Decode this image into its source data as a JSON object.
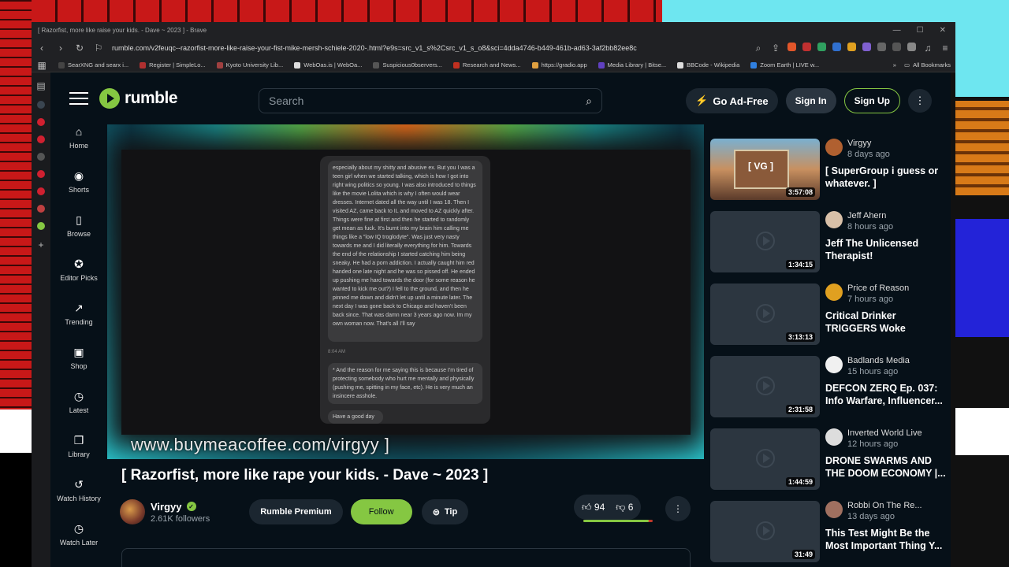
{
  "browser": {
    "title": "[ Razorfist, more like raise your kids. - Dave ~ 2023 ] - Brave",
    "url": "rumble.com/v2feuqc--razorfist-more-like-raise-your-fist-mike-mersh-schiele-2020-.html?e9s=src_v1_s%2Csrc_v1_s_o8&sci=4dda4746-b449-461b-ad63-3af2bb82ee8c",
    "window_controls": [
      "—",
      "☐",
      "✕"
    ],
    "bookmarks": [
      {
        "label": "SearXNG and searx i...",
        "color": "#444"
      },
      {
        "label": "Register | SimpleLo...",
        "color": "#b03030"
      },
      {
        "label": "Kyoto University Lib...",
        "color": "#a04040"
      },
      {
        "label": "WebOas.is | WebOa...",
        "color": "#ddd"
      },
      {
        "label": "Suspicious0bservers...",
        "color": "#555"
      },
      {
        "label": "Research and News...",
        "color": "#c03020"
      },
      {
        "label": "https://gradio.app",
        "color": "#e0a040"
      },
      {
        "label": "Media Library | Bitse...",
        "color": "#6040c0"
      },
      {
        "label": "BBCode - Wikipedia",
        "color": "#ddd"
      },
      {
        "label": "Zoom Earth | LIVE w...",
        "color": "#3080e0"
      }
    ],
    "all_bookmarks": "All Bookmarks"
  },
  "header": {
    "logo_text": "rumble",
    "search_placeholder": "Search",
    "adfree_label": "Go Ad-Free",
    "signin_label": "Sign In",
    "signup_label": "Sign Up"
  },
  "sidebar": {
    "items": [
      {
        "name": "home",
        "label": "Home",
        "icon": "⌂"
      },
      {
        "name": "shorts",
        "label": "Shorts",
        "icon": "◉"
      },
      {
        "name": "browse",
        "label": "Browse",
        "icon": "▯"
      },
      {
        "name": "editor-picks",
        "label": "Editor Picks",
        "icon": "✪"
      },
      {
        "name": "trending",
        "label": "Trending",
        "icon": "↗"
      },
      {
        "name": "shop",
        "label": "Shop",
        "icon": "▣"
      },
      {
        "name": "latest",
        "label": "Latest",
        "icon": "◷"
      },
      {
        "name": "library",
        "label": "Library",
        "icon": "❐"
      },
      {
        "name": "watch-history",
        "label": "Watch History",
        "icon": "↺"
      },
      {
        "name": "watch-later",
        "label": "Watch Later",
        "icon": "◷"
      }
    ]
  },
  "video": {
    "overlay_url": "www.buymeacoffee.com/virgyy ]",
    "chat_text_1": "especially about my shitty and abusive ex. But you I was a teen girl when we started talking, which is how I got into right wing politics so young. I was also introduced to things like the movie Lolita which is why I often would wear dresses. Internet dated all the way until I was 18. Then I visited AZ, came back to IL and moved to AZ quickly after. Things were fine at first and then he started to randomly get mean as fuck. It's burnt into my brain him calling me things like a \"low IQ troglodyte\". Was just very nasty towards me and I did literally everything for him. Towards the end of the relationship I started catching him being sneaky. He had a porn addiction. I actually caught him red handed one late night and he was so pissed off. He ended up pushing me hard towards the door (for some reason he wanted to kick me out?) I fell to the ground, and then he pinned me down and didn't let up until a minute later. The next day I was gone back to Chicago and haven't been back since. That was damn near 3 years ago now. Im my own woman now. That's all I'll say",
    "chat_time": "8:04 AM",
    "chat_text_2": "* And the reason for me saying this is because I'm tired of protecting somebody who hurt me mentally and physically (pushing me, spitting in my face, etc). He is very much an insincere asshole.",
    "chat_text_3": "Have a good day",
    "title": "[ Razorfist, more like rape your kids. - Dave ~ 2023 ]"
  },
  "channel": {
    "name": "Virgyy",
    "followers": "2.61K followers",
    "premium_label": "Rumble Premium",
    "follow_label": "Follow",
    "tip_label": "Tip",
    "likes": "94",
    "dislikes": "6",
    "like_ratio": 0.94
  },
  "related": [
    {
      "channel": "Virgyy",
      "ago": "8 days ago",
      "title": "[ SuperGroup i guess or whatever. ]",
      "duration": "3:57:08",
      "avatar_color": "#b06030",
      "thumb_label": "[ VG ]"
    },
    {
      "channel": "Jeff Ahern",
      "ago": "8 hours ago",
      "title": "Jeff The Unlicensed Therapist!",
      "duration": "1:34:15",
      "avatar_color": "#d8c0a8"
    },
    {
      "channel": "Price of Reason",
      "ago": "7 hours ago",
      "title": "Critical Drinker TRIGGERS Woke Hollywood...",
      "duration": "3:13:13",
      "avatar_color": "#e0a020"
    },
    {
      "channel": "Badlands Media",
      "ago": "15 hours ago",
      "title": "DEFCON ZERQ Ep. 037: Info Warfare, Influencer...",
      "duration": "2:31:58",
      "avatar_color": "#f0f0f0"
    },
    {
      "channel": "Inverted World Live",
      "ago": "12 hours ago",
      "title": "DRONE SWARMS AND THE DOOM ECONOMY |...",
      "duration": "1:44:59",
      "avatar_color": "#ddd"
    },
    {
      "channel": "Robbi On The Re...",
      "ago": "13 days ago",
      "title": "This Test Might Be the Most Important Thing Y...",
      "duration": "31:49",
      "avatar_color": "#a07060"
    }
  ],
  "colors": {
    "accent": "#85c742",
    "bg": "#061018"
  }
}
